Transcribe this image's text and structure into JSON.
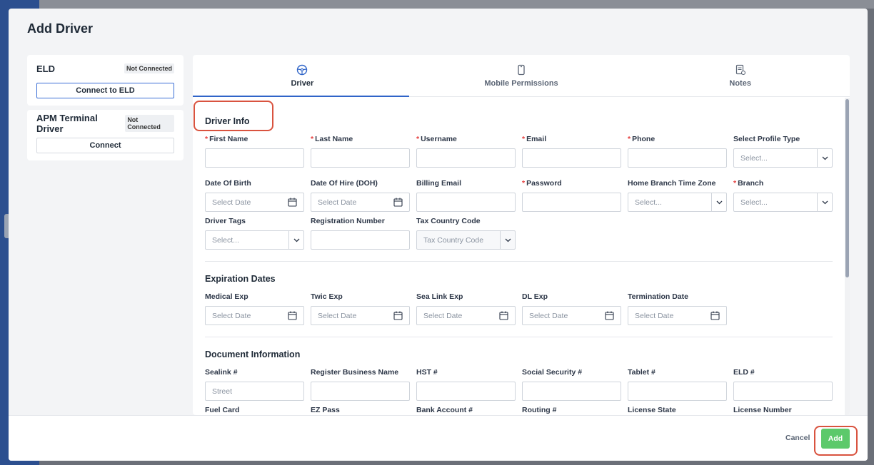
{
  "modal": {
    "title": "Add Driver"
  },
  "left": {
    "eld": {
      "title": "ELD",
      "status": "Not Connected",
      "button": "Connect to ELD"
    },
    "apm": {
      "title": "APM Terminal Driver",
      "status": "Not Connected",
      "button": "Connect"
    }
  },
  "tabs": [
    {
      "label": "Driver",
      "icon": "steering-wheel-icon",
      "active": true
    },
    {
      "label": "Mobile Permissions",
      "icon": "phone-icon",
      "active": false
    },
    {
      "label": "Notes",
      "icon": "notes-icon",
      "active": false
    }
  ],
  "driver_info": {
    "title": "Driver Info",
    "fields": [
      {
        "label": "First Name",
        "required": true,
        "type": "text",
        "placeholder": ""
      },
      {
        "label": "Last Name",
        "required": true,
        "type": "text",
        "placeholder": ""
      },
      {
        "label": "Username",
        "required": true,
        "type": "text",
        "placeholder": ""
      },
      {
        "label": "Email",
        "required": true,
        "type": "text",
        "placeholder": ""
      },
      {
        "label": "Phone",
        "required": true,
        "type": "text",
        "placeholder": ""
      },
      {
        "label": "Select Profile Type",
        "required": false,
        "type": "select",
        "placeholder": "Select..."
      },
      {
        "label": "Date Of Birth",
        "required": false,
        "type": "date",
        "placeholder": "Select Date"
      },
      {
        "label": "Date Of Hire (DOH)",
        "required": false,
        "type": "date",
        "placeholder": "Select Date"
      },
      {
        "label": "Billing Email",
        "required": false,
        "type": "text",
        "placeholder": ""
      },
      {
        "label": "Password",
        "required": true,
        "type": "text",
        "placeholder": ""
      },
      {
        "label": "Home Branch Time Zone",
        "required": false,
        "type": "select",
        "placeholder": "Select..."
      },
      {
        "label": "Branch",
        "required": true,
        "type": "select",
        "placeholder": "Select..."
      },
      {
        "label": "Driver Tags",
        "required": false,
        "type": "select",
        "placeholder": "Select..."
      },
      {
        "label": "Registration Number",
        "required": false,
        "type": "text",
        "placeholder": ""
      },
      {
        "label": "Tax Country Code",
        "required": false,
        "type": "select",
        "placeholder": "Tax Country Code"
      }
    ]
  },
  "expiration": {
    "title": "Expiration Dates",
    "fields": [
      {
        "label": "Medical Exp",
        "placeholder": "Select Date"
      },
      {
        "label": "Twic Exp",
        "placeholder": "Select Date"
      },
      {
        "label": "Sea Link Exp",
        "placeholder": "Select Date"
      },
      {
        "label": "DL Exp",
        "placeholder": "Select Date"
      },
      {
        "label": "Termination Date",
        "placeholder": "Select Date"
      }
    ]
  },
  "document": {
    "title": "Document Information",
    "fields": [
      {
        "label": "Sealink #",
        "placeholder": "Street"
      },
      {
        "label": "Register Business Name",
        "placeholder": ""
      },
      {
        "label": "HST #",
        "placeholder": ""
      },
      {
        "label": "Social Security #",
        "placeholder": ""
      },
      {
        "label": "Tablet #",
        "placeholder": ""
      },
      {
        "label": "ELD #",
        "placeholder": ""
      },
      {
        "label": "Fuel Card",
        "placeholder": ""
      },
      {
        "label": "EZ Pass",
        "placeholder": ""
      },
      {
        "label": "Bank Account #",
        "placeholder": ""
      },
      {
        "label": "Routing #",
        "placeholder": ""
      },
      {
        "label": "License State",
        "placeholder": ""
      },
      {
        "label": "License Number",
        "placeholder": ""
      }
    ]
  },
  "footer": {
    "cancel": "Cancel",
    "add": "Add"
  },
  "colors": {
    "accent": "#2f64c8",
    "add_button": "#5cc96b",
    "required": "#e53e3e",
    "highlight": "#d9533f"
  }
}
